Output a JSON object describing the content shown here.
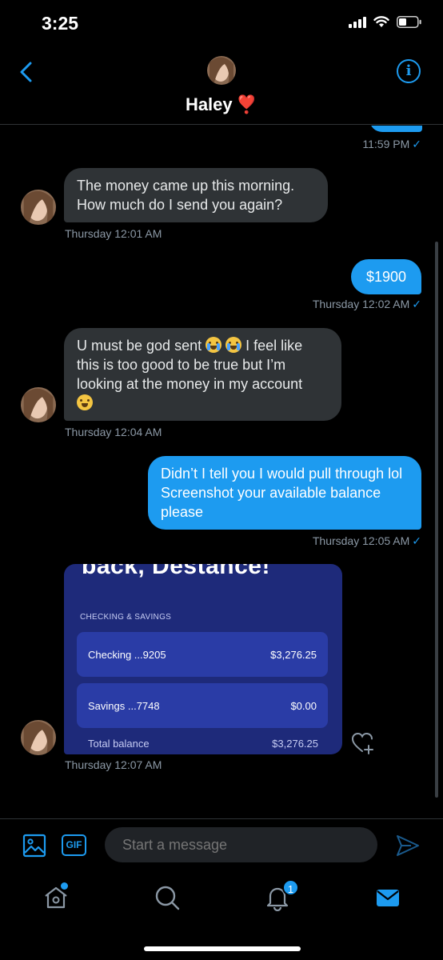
{
  "status_bar": {
    "time": "3:25"
  },
  "header": {
    "contact_name": "Haley",
    "name_emoji": "❣️"
  },
  "messages": [
    {
      "direction": "out",
      "text": "",
      "timestamp": "11:59 PM"
    },
    {
      "direction": "in",
      "text": "The money came up this morning. How much do I send you again?",
      "timestamp": "Thursday 12:01 AM"
    },
    {
      "direction": "out",
      "text": "$1900",
      "timestamp": "Thursday 12:02 AM"
    },
    {
      "direction": "in",
      "text_part1": "U must be god sent",
      "text_part2": "I feel like this is too good to be true but I’m looking at the money in my account",
      "timestamp": "Thursday 12:04 AM"
    },
    {
      "direction": "out",
      "text": "Didn’t I tell you I would pull through lol Screenshot your available balance please",
      "timestamp": "Thursday 12:05 AM"
    },
    {
      "direction": "in",
      "type": "image",
      "timestamp": "Thursday 12:07 AM"
    }
  ],
  "read_receipt": "✓",
  "shared_image": {
    "heading": "back, Destance!",
    "section_label": "CHECKING & SAVINGS",
    "accounts": [
      {
        "name": "Checking ...9205",
        "amount": "$3,276.25"
      },
      {
        "name": "Savings ...7748",
        "amount": "$0.00"
      }
    ],
    "total_label": "Total balance",
    "total_amount": "$3,276.25"
  },
  "composer": {
    "placeholder": "Start a message",
    "gif_label": "GIF"
  },
  "tabbar": {
    "notifications_count": "1"
  },
  "colors": {
    "accent": "#1d9bf0",
    "incoming_bubble": "#2f3336",
    "card_bg": "#1e2a7a",
    "card_row": "#2a3ca6"
  },
  "icons": [
    "back-chevron-icon",
    "info-icon",
    "image-icon",
    "gif-icon",
    "send-icon",
    "home-icon",
    "search-icon",
    "bell-icon",
    "mail-icon",
    "heart-plus-icon"
  ]
}
